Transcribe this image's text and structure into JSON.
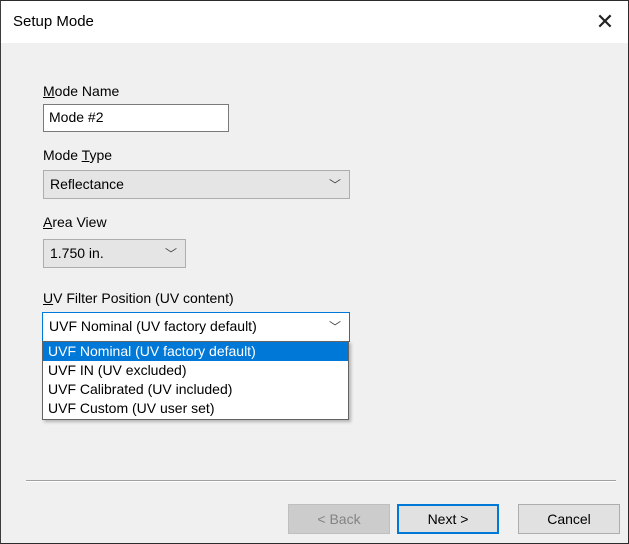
{
  "window": {
    "title": "Setup Mode",
    "close_glyph": "✕"
  },
  "mode_name": {
    "label": "Mode Name",
    "value": "Mode #2"
  },
  "mode_type": {
    "label": "Mode Type",
    "value": "Reflectance"
  },
  "area_view": {
    "label": "Area View",
    "value": "1.750 in."
  },
  "uv_filter": {
    "label": "UV Filter Position (UV content)",
    "value": "UVF Nominal (UV factory default)",
    "options": [
      "UVF Nominal (UV factory default)",
      "UVF IN (UV excluded)",
      "UVF Calibrated (UV included)",
      "UVF Custom (UV user set)"
    ],
    "selected_index": 0
  },
  "buttons": {
    "back": "< Back",
    "next": "Next >",
    "cancel": "Cancel"
  },
  "icons": {
    "chevron": "chevron-down-icon",
    "close": "close-icon"
  },
  "colors": {
    "accent": "#0078d7"
  }
}
